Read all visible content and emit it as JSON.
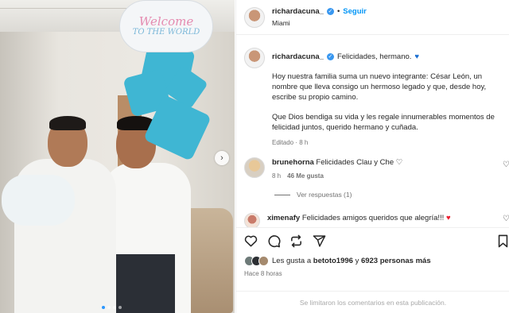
{
  "photo": {
    "balloon_line1": "Welcome",
    "balloon_line2": "TO THE WORLD",
    "next_icon": "chevron-right-icon",
    "carousel_dots": 4,
    "carousel_active_index": 1
  },
  "header": {
    "username": "richardacuna_",
    "separator": "•",
    "follow_label": "Seguir",
    "location": "Miami"
  },
  "caption": {
    "username": "richardacuna_",
    "first_line": "Felicidades, hermano.",
    "paragraph1": "Hoy nuestra familia suma un nuevo integrante: César León, un nombre que lleva consigo un hermoso legado y que, desde hoy, escribe su propio camino.",
    "paragraph2": "Que Dios bendiga su vida y les regale innumerables momentos de felicidad juntos, querido hermano y cuñada.",
    "meta": "Editado · 8 h"
  },
  "comments": [
    {
      "username": "brunehorna",
      "text": "Felicidades Clau y Che",
      "time": "8 h",
      "likes": "46 Me gusta",
      "replies": "Ver respuestas (1)"
    },
    {
      "username": "ximenafy",
      "text": "Felicidades amigos queridos que alegría!!!"
    }
  ],
  "likes": {
    "prefix": "Les gusta a",
    "user": "betoto1996",
    "middle": "y",
    "count": "6923 personas más"
  },
  "time_ago": "Hace 8 horas",
  "comments_limited": "Se limitaron los comentarios en esta publicación.",
  "colors": {
    "accent": "#0095f6",
    "verified": "#3897f0",
    "balloon_blue": "#3fb6d3",
    "heart_red": "#ed1c2e"
  }
}
